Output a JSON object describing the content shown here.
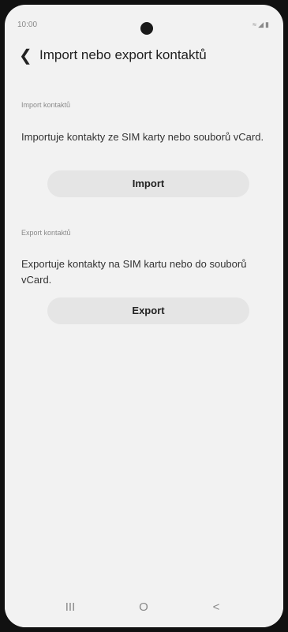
{
  "status": {
    "time": "10:00"
  },
  "header": {
    "title": "Import nebo export kontaktů"
  },
  "import_section": {
    "label": "Import kontaktů",
    "description": "Importuje kontakty ze SIM karty nebo souborů vCard.",
    "button_label": "Import"
  },
  "export_section": {
    "label": "Export kontaktů",
    "description": "Exportuje kontakty na SIM kartu nebo do souborů vCard.",
    "button_label": "Export"
  },
  "navbar": {
    "recents": "III",
    "home": "O",
    "back": "<"
  }
}
